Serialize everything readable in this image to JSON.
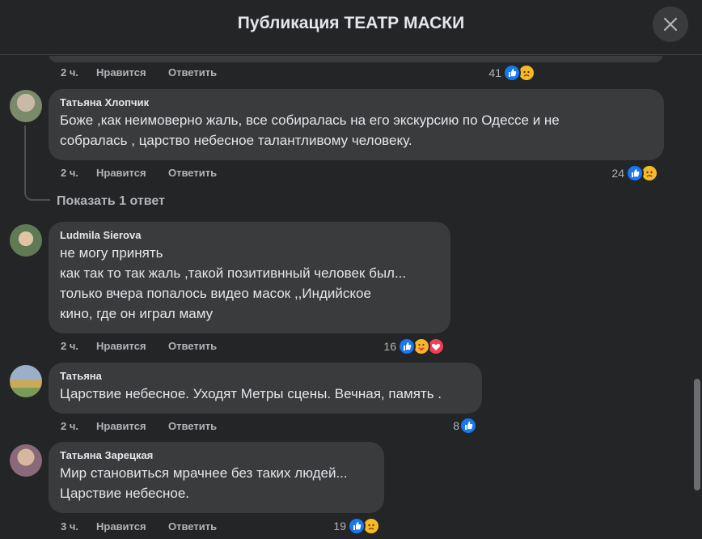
{
  "header": {
    "title": "Публикация ТЕАТР МАСКИ"
  },
  "actions": {
    "like": "Нравится",
    "reply": "Ответить"
  },
  "top_meta": {
    "time": "2 ч.",
    "reactions": "41"
  },
  "comments": [
    {
      "author": "Татьяна Хлопчик",
      "lines": [
        "Боже ,как неимоверно жаль, все собиралась на его экскурсию по Одессе и не",
        "собралась , царство небесное талантливому человеку."
      ],
      "time": "2 ч.",
      "reactions": "24",
      "show_replies": "Показать 1 ответ"
    },
    {
      "author": "Ludmila Sierova",
      "lines": [
        "не могу принять",
        "как так то так жаль ,такой позитивнный человек был...",
        "только вчера попалось видео масок ,,Индийское",
        "кино, где он играл маму"
      ],
      "time": "2 ч.",
      "reactions": "16"
    },
    {
      "author": "Татьяна",
      "lines": [
        "Царствие небесное. Уходят Метры сцены. Вечная, память ."
      ],
      "time": "2 ч.",
      "reactions": "8"
    },
    {
      "author": "Татьяна Зарецкая",
      "lines": [
        "Мир становиться мрачнее без таких людей...",
        "Царствие небесное."
      ],
      "time": "3 ч.",
      "reactions": "19"
    }
  ],
  "colors": {
    "like_blue": "#1877f2",
    "sad_yellow": "#f7b928",
    "love_red": "#f33e58"
  },
  "icons": [
    "close-icon",
    "like-reaction-icon",
    "sad-reaction-icon",
    "care-reaction-icon",
    "love-reaction-icon"
  ]
}
